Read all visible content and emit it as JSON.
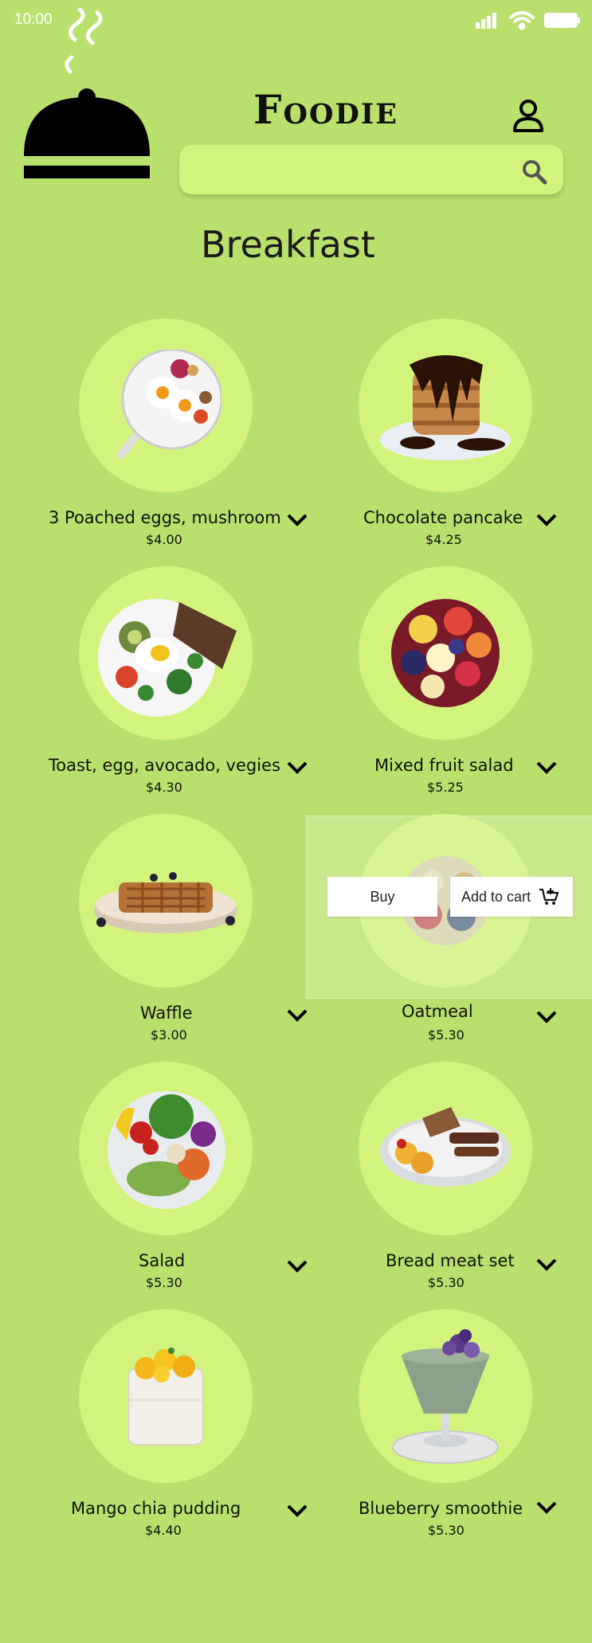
{
  "status_bar": {
    "time": "10:00"
  },
  "app": {
    "brand": "Foodie"
  },
  "search": {
    "placeholder": ""
  },
  "section": {
    "title": "Breakfast"
  },
  "items": [
    {
      "name": "3 Poached eggs, mushroom",
      "price": "$4.00",
      "image": "eggs-skillet"
    },
    {
      "name": "Chocolate pancake",
      "price": "$4.25",
      "image": "pancake-stack"
    },
    {
      "name": "Toast, egg, avocado, vegies",
      "price": "$4.30",
      "image": "toast-plate"
    },
    {
      "name": "Mixed fruit salad",
      "price": "$5.25",
      "image": "fruit-bowl"
    },
    {
      "name": "Waffle",
      "price": "$3.00",
      "image": "waffle-plate"
    },
    {
      "name": "Oatmeal",
      "price": "$5.30",
      "image": "oatmeal-bowl"
    },
    {
      "name": "Salad",
      "price": "$5.30",
      "image": "salad-bowl"
    },
    {
      "name": "Bread meat set",
      "price": "$5.30",
      "image": "meat-plate"
    },
    {
      "name": "Mango chia pudding",
      "price": "$4.40",
      "image": "chia-jar"
    },
    {
      "name": "Blueberry smoothie",
      "price": "$5.30",
      "image": "smoothie-glass"
    }
  ],
  "popup": {
    "buy_label": "Buy",
    "add_to_cart_label": "Add to cart",
    "for_item": "Oatmeal"
  },
  "colors": {
    "background": "#b9e06d",
    "accent": "#d2f47c"
  }
}
